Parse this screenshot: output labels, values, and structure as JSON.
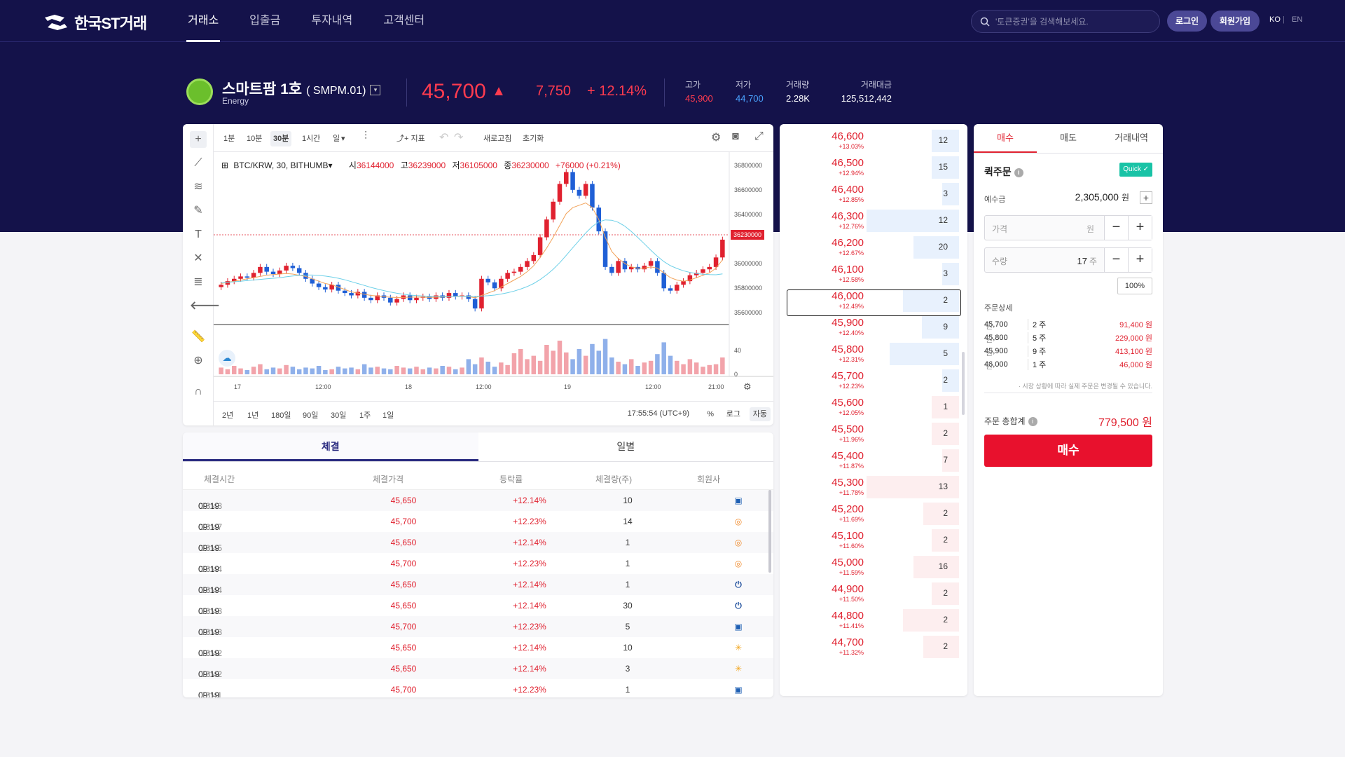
{
  "nav": {
    "logo": "한국ST거래",
    "menu": [
      "거래소",
      "입출금",
      "투자내역",
      "고객센터"
    ],
    "search_placeholder": "'토큰증권'을 검색해보세요.",
    "login": "로그인",
    "signup": "회원가입",
    "lang": [
      "KO",
      "EN"
    ]
  },
  "ticker": {
    "name": "스마트팜 1호",
    "code": "( SMPM.01)",
    "sector": "Energy",
    "price": "45,700",
    "change": "7,750",
    "change_pct": "+ 12.14%",
    "stats": [
      {
        "label": "고가",
        "value": "45,900",
        "color": "#ff3b4f"
      },
      {
        "label": "저가",
        "value": "44,700",
        "color": "#4aa3ff"
      },
      {
        "label": "거래량",
        "value": "2.28K",
        "color": "#ffffff"
      },
      {
        "label": "거래대금",
        "value": "125,512,442",
        "color": "#ffffff"
      }
    ]
  },
  "chart": {
    "timeframes": [
      "1분",
      "10분",
      "30분",
      "1시간",
      "일"
    ],
    "active_timeframe": "30분",
    "indicator_label": "지표",
    "refresh_label": "새로고침",
    "reset_label": "초기화",
    "symbol": "BTC/KRW, 30, BITHUMB",
    "ohlc": {
      "o_label": "시",
      "o": "36144000",
      "h_label": "고",
      "h": "36239000",
      "l_label": "저",
      "l": "36105000",
      "c_label": "종",
      "c": "36230000",
      "chg": "+76000 (+0.21%)"
    },
    "price_ticks": [
      "36800000",
      "36600000",
      "36400000",
      "36200000",
      "36000000",
      "35800000",
      "35600000"
    ],
    "last_price_tag": "36230000",
    "volume_ticks": [
      "40",
      "0"
    ],
    "time_ticks": [
      "17",
      "12:00",
      "18",
      "12:00",
      "19",
      "12:00",
      "21:00"
    ],
    "ranges": [
      "2년",
      "1년",
      "180일",
      "90일",
      "30일",
      "1주",
      "1일"
    ],
    "clock": "17:55:54 (UTC+9)",
    "scale_buttons": [
      "%",
      "로그",
      "자동"
    ]
  },
  "chart_data": {
    "type": "candlestick",
    "title": "BTC/KRW, 30, BITHUMB",
    "ylim": [
      35500000,
      36900000
    ],
    "x_ticks": [
      "17",
      "12:00",
      "18",
      "12:00",
      "19",
      "12:00",
      "21:00"
    ],
    "close": [
      35850000,
      35880000,
      35900000,
      35920000,
      35910000,
      35950000,
      36000000,
      35960000,
      35940000,
      35970000,
      36010000,
      35990000,
      35950000,
      35900000,
      35860000,
      35830000,
      35810000,
      35850000,
      35800000,
      35780000,
      35760000,
      35790000,
      35740000,
      35720000,
      35760000,
      35740000,
      35700000,
      35730000,
      35760000,
      35720000,
      35740000,
      35750000,
      35730000,
      35760000,
      35740000,
      35780000,
      35750000,
      35760000,
      35730000,
      35650000,
      35900000,
      35870000,
      35820000,
      35900000,
      35950000,
      35960000,
      36000000,
      36050000,
      36100000,
      36250000,
      36400000,
      36550000,
      36700000,
      36800000,
      36650000,
      36600000,
      36700000,
      36500000,
      36300000,
      36000000,
      35950000,
      36050000,
      35980000,
      36000000,
      35980000,
      36010000,
      36050000,
      35950000,
      35820000,
      35800000,
      35850000,
      35880000,
      35930000,
      35950000,
      35980000,
      36000000,
      36080000,
      36230000
    ],
    "ma_short": [
      35860,
      35870,
      35880,
      35890,
      35900,
      35910,
      35920,
      35930,
      35935,
      35940,
      35945,
      35940,
      35930,
      35920,
      35900,
      35880,
      35860,
      35850,
      35830,
      35810,
      35790,
      35780,
      35770,
      35760,
      35755,
      35750,
      35745,
      35742,
      35744,
      35745,
      35746,
      35745,
      35744,
      35745,
      35746,
      35750,
      35752,
      35755,
      35750,
      35740,
      35760,
      35780,
      35800,
      35830,
      35860,
      35890,
      35920,
      35960,
      36010,
      36080,
      36160,
      36250,
      36350,
      36450,
      36500,
      36520,
      36540,
      36500,
      36400,
      36250,
      36130,
      36070,
      36030,
      36000,
      35990,
      35990,
      36000,
      35990,
      35950,
      35910,
      35890,
      35880,
      35890,
      35910,
      35930,
      35950,
      35990,
      36060
    ],
    "volume": [
      8,
      6,
      10,
      7,
      5,
      9,
      12,
      6,
      8,
      7,
      11,
      9,
      6,
      8,
      7,
      10,
      5,
      6,
      9,
      7,
      8,
      6,
      12,
      8,
      9,
      7,
      6,
      10,
      8,
      7,
      9,
      6,
      8,
      7,
      10,
      9,
      6,
      8,
      18,
      12,
      20,
      15,
      9,
      14,
      11,
      25,
      30,
      18,
      22,
      16,
      35,
      28,
      40,
      26,
      18,
      30,
      22,
      36,
      28,
      42,
      20,
      15,
      12,
      18,
      10,
      14,
      16,
      24,
      38,
      22,
      16,
      12,
      18,
      14,
      9,
      11,
      12,
      20
    ]
  },
  "trades": {
    "tabs": [
      "체결",
      "일별"
    ],
    "headers": [
      "체결시간",
      "체결가격",
      "등락률",
      "체결량(주)",
      "회원사"
    ],
    "rows": [
      {
        "date": "09:19",
        "time": "13:48",
        "price": "45,650",
        "rate": "+12.14%",
        "qty": "10",
        "member": "IBK"
      },
      {
        "date": "09:19",
        "time": "13:47",
        "price": "45,700",
        "rate": "+12.23%",
        "qty": "14",
        "member": "Q"
      },
      {
        "date": "09:19",
        "time": "13:45",
        "price": "45,650",
        "rate": "+12.14%",
        "qty": "1",
        "member": "Q"
      },
      {
        "date": "09:19",
        "time": "13:44",
        "price": "45,700",
        "rate": "+12.23%",
        "qty": "1",
        "member": "Q"
      },
      {
        "date": "09:19",
        "time": "13:44",
        "price": "45,650",
        "rate": "+12.14%",
        "qty": "1",
        "member": "U"
      },
      {
        "date": "09:19",
        "time": "13:43",
        "price": "45,650",
        "rate": "+12.14%",
        "qty": "30",
        "member": "U"
      },
      {
        "date": "09:19",
        "time": "13:43",
        "price": "45,700",
        "rate": "+12.23%",
        "qty": "5",
        "member": "IBK"
      },
      {
        "date": "09:19",
        "time": "13:42",
        "price": "45,650",
        "rate": "+12.14%",
        "qty": "10",
        "member": "KB"
      },
      {
        "date": "09:19",
        "time": "13:42",
        "price": "45,650",
        "rate": "+12.14%",
        "qty": "3",
        "member": "KB"
      },
      {
        "date": "09:19",
        "time": "13:41",
        "price": "45,700",
        "rate": "+12.23%",
        "qty": "1",
        "member": "IBK"
      }
    ]
  },
  "orderbook": {
    "rows": [
      {
        "price": "46,600",
        "rate": "+13.03%",
        "qty": "12",
        "side": "blue",
        "frac": 0.14
      },
      {
        "price": "46,500",
        "rate": "+12.94%",
        "qty": "15",
        "side": "blue",
        "frac": 0.14
      },
      {
        "price": "46,400",
        "rate": "+12.85%",
        "qty": "3",
        "side": "blue",
        "frac": 0.0
      },
      {
        "price": "46,300",
        "rate": "+12.76%",
        "qty": "12",
        "side": "blue",
        "frac": 1.0
      },
      {
        "price": "46,200",
        "rate": "+12.67%",
        "qty": "20",
        "side": "blue",
        "frac": 0.38
      },
      {
        "price": "46,100",
        "rate": "+12.58%",
        "qty": "3",
        "side": "blue",
        "frac": 0.0
      },
      {
        "price": "46,000",
        "rate": "+12.49%",
        "qty": "2",
        "side": "blue",
        "frac": 0.52
      },
      {
        "price": "45,900",
        "rate": "+12.40%",
        "qty": "9",
        "side": "blue",
        "frac": 0.27
      },
      {
        "price": "45,800",
        "rate": "+12.31%",
        "qty": "5",
        "side": "blue",
        "frac": 0.69
      },
      {
        "price": "45,700",
        "rate": "+12.23%",
        "qty": "2",
        "side": "blue",
        "frac": 0.0
      },
      {
        "price": "45,600",
        "rate": "+12.05%",
        "qty": "1",
        "side": "red",
        "frac": 0.14
      },
      {
        "price": "45,500",
        "rate": "+11.96%",
        "qty": "2",
        "side": "red",
        "frac": 0.14
      },
      {
        "price": "45,400",
        "rate": "+11.87%",
        "qty": "7",
        "side": "red",
        "frac": 0.0
      },
      {
        "price": "45,300",
        "rate": "+11.78%",
        "qty": "13",
        "side": "red",
        "frac": 1.0
      },
      {
        "price": "45,200",
        "rate": "+11.69%",
        "qty": "2",
        "side": "red",
        "frac": 0.25
      },
      {
        "price": "45,100",
        "rate": "+11.60%",
        "qty": "2",
        "side": "red",
        "frac": 0.14
      },
      {
        "price": "45,000",
        "rate": "+11.59%",
        "qty": "16",
        "side": "red",
        "frac": 0.38
      },
      {
        "price": "44,900",
        "rate": "+11.50%",
        "qty": "2",
        "side": "red",
        "frac": 0.14
      },
      {
        "price": "44,800",
        "rate": "+11.41%",
        "qty": "2",
        "side": "red",
        "frac": 0.52
      },
      {
        "price": "44,700",
        "rate": "+11.32%",
        "qty": "2",
        "side": "red",
        "frac": 0.25
      }
    ]
  },
  "order": {
    "tabs": [
      "매수",
      "매도",
      "거래내역"
    ],
    "quick_title": "퀵주문",
    "quick_badge": "Quick",
    "deposit_label": "예수금",
    "deposit_value": "2,305,000",
    "deposit_unit": "원",
    "price_label": "가격",
    "price_unit": "원",
    "qty_label": "수량",
    "qty_value": "17",
    "qty_unit": "주",
    "pct": "100%",
    "detail_title": "주문상세",
    "details": [
      {
        "price": "45,700",
        "unit": "원",
        "qty": "2 주",
        "total": "91,400 원"
      },
      {
        "price": "45,800",
        "unit": "원",
        "qty": "5 주",
        "total": "229,000 원"
      },
      {
        "price": "45,900",
        "unit": "원",
        "qty": "9 주",
        "total": "413,100 원"
      },
      {
        "price": "46,000",
        "unit": "원",
        "qty": "1 주",
        "total": "46,000 원"
      }
    ],
    "note": "· 시장 상황에 따라 실제 주문은 변경될 수 있습니다.",
    "total_label": "주문 총합계",
    "total_value": "779,500 원",
    "buy_button": "매수"
  }
}
